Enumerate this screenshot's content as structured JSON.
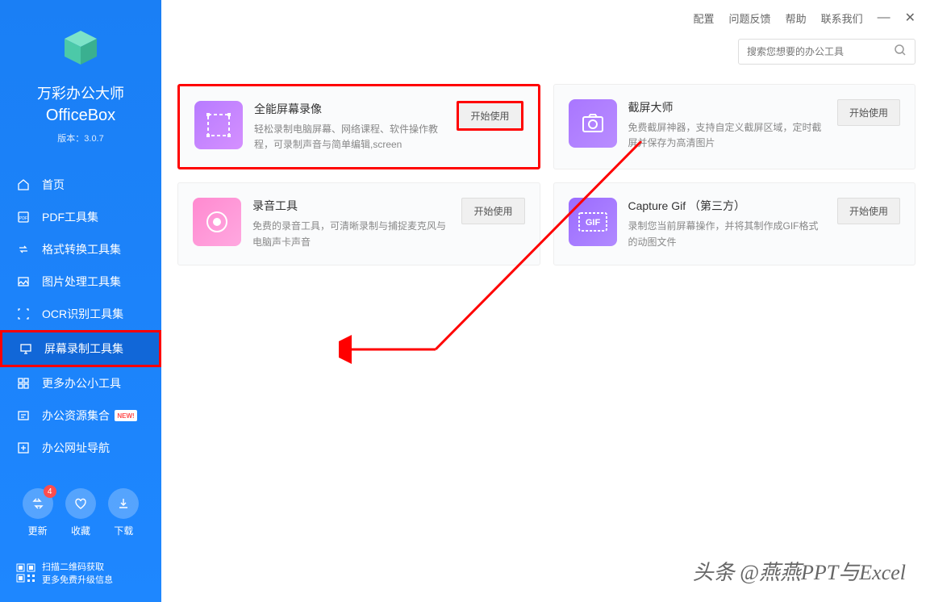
{
  "app": {
    "title": "万彩办公大师",
    "subtitle": "OfficeBox",
    "version": "版本：3.0.7"
  },
  "sidebar": {
    "items": [
      {
        "label": "首页"
      },
      {
        "label": "PDF工具集"
      },
      {
        "label": "格式转换工具集"
      },
      {
        "label": "图片处理工具集"
      },
      {
        "label": "OCR识别工具集"
      },
      {
        "label": "屏幕录制工具集"
      },
      {
        "label": "更多办公小工具"
      },
      {
        "label": "办公资源集合"
      },
      {
        "label": "办公网址导航"
      }
    ],
    "actions": [
      {
        "label": "更新",
        "badge": "4"
      },
      {
        "label": "收藏"
      },
      {
        "label": "下载"
      }
    ],
    "qr": {
      "line1": "扫描二维码获取",
      "line2": "更多免费升级信息"
    }
  },
  "top_menu": {
    "config": "配置",
    "feedback": "问题反馈",
    "help": "帮助",
    "contact": "联系我们"
  },
  "search": {
    "placeholder": "搜索您想要的办公工具"
  },
  "tools": [
    {
      "title": "全能屏幕录像",
      "desc": "轻松录制电脑屏幕、网络课程、软件操作教程，可录制声音与简单编辑,screen",
      "btn": "开始使用"
    },
    {
      "title": "截屏大师",
      "desc": "免费截屏神器，支持自定义截屏区域，定时截屏并保存为高清图片",
      "btn": "开始使用"
    },
    {
      "title": "录音工具",
      "desc": "免费的录音工具，可清晰录制与捕捉麦克风与电脑声卡声音",
      "btn": "开始使用"
    },
    {
      "title": "Capture Gif （第三方）",
      "desc": "录制您当前屏幕操作，并将其制作成GIF格式的动图文件",
      "btn": "开始使用"
    }
  ],
  "watermark": "头条 @燕燕PPT与Excel"
}
